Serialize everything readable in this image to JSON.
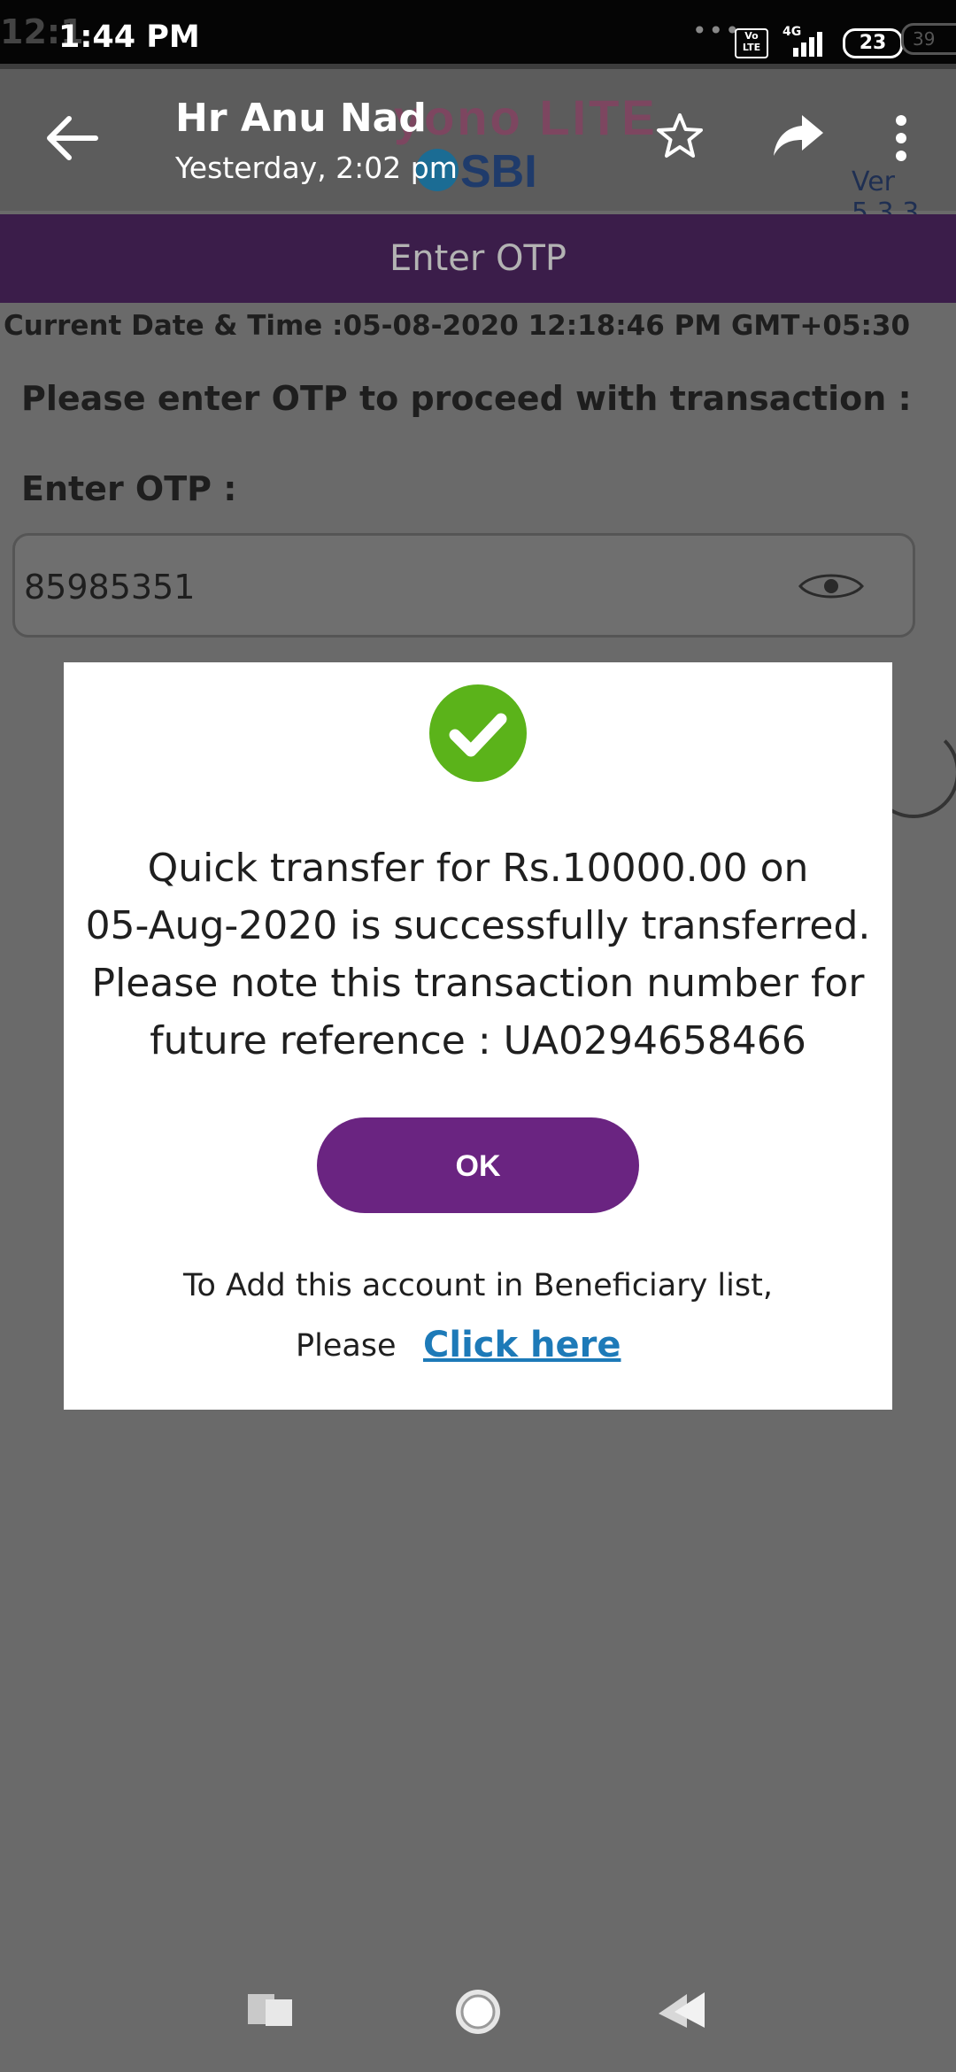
{
  "status_bar": {
    "ghost_time": "12:1",
    "time": "1:44 PM",
    "dots": "•••",
    "volte": "Vo LTE",
    "network": "4G",
    "battery": "23",
    "ghost_battery": "39"
  },
  "app_bar": {
    "contact_name": "Hr Anu Nad",
    "timestamp": "Yesterday, 2:02 pm",
    "logo_top": "yono LITE",
    "logo_bottom": "SBI",
    "version": "Ver 5.3.3"
  },
  "screen": {
    "header_title": "Enter OTP",
    "current_datetime": "Current Date & Time :05-08-2020 12:18:46 PM GMT+05:30",
    "instruction": "Please enter OTP to proceed with transaction :",
    "otp_label": "Enter OTP :",
    "otp_value": "85985351"
  },
  "dialog": {
    "message_lines": [
      "Quick transfer for Rs.10000.00 on",
      "05-Aug-2020 is successfully transferred.",
      "Please note this transaction number for",
      "future reference : UA0294658466"
    ],
    "ok_label": "OK",
    "add_line": "To Add this account in Beneficiary list,",
    "please": "Please",
    "link_label": "Click here",
    "success_color": "#5bb31a",
    "button_color": "#6a2481",
    "link_color": "#1d7ab8"
  },
  "icons": {
    "back": "arrow-left",
    "star": "star-outline",
    "share": "share-arrow",
    "more": "vertical-dots",
    "eye": "eye",
    "check": "check-circle",
    "nav_recent": "recent-apps",
    "nav_home": "home-circle",
    "nav_back": "back-triangle"
  }
}
